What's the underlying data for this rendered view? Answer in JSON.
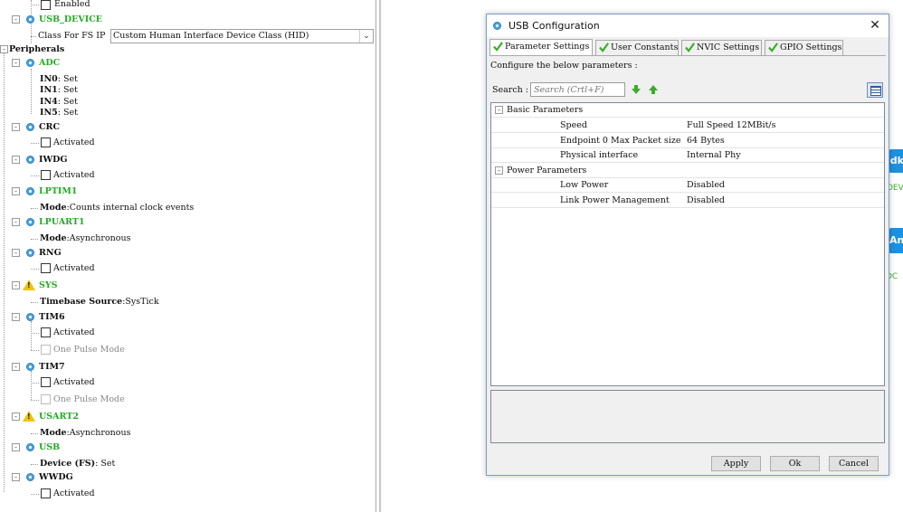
{
  "tree": {
    "enabled_label": "Enabled",
    "usb_device": "USB_DEVICE",
    "class_label": "Class For FS IP",
    "class_value": "Custom Human Interface Device Class (HID)",
    "peripherals": "Peripherals",
    "adc": "ADC",
    "in0": "IN0",
    "in1": "IN1",
    "in4": "IN4",
    "in5": "IN5",
    "set_value": "Set",
    "crc": "CRC",
    "activated": "Activated",
    "iwdg": "IWDG",
    "lptim1": "LPTIM1",
    "mode_label": "Mode",
    "lptim1_mode": "Counts internal clock events",
    "lpuart1": "LPUART1",
    "async": "Asynchronous",
    "rng": "RNG",
    "sys": "SYS",
    "timebase_label": "Timebase Source",
    "timebase_value": "SysTick",
    "tim6": "TIM6",
    "one_pulse": "One Pulse Mode",
    "tim7": "TIM7",
    "usart2": "USART2",
    "usb": "USB",
    "device_fs_label": "Device (FS)",
    "wwdg": "WWDG",
    "sep": ":"
  },
  "dialog": {
    "title": "USB Configuration",
    "close": "✕",
    "tabs": [
      "Parameter Settings",
      "User Constants",
      "NVIC Settings",
      "GPIO Settings"
    ],
    "description": "Configure the below parameters :",
    "search_label": "Search :",
    "search_placeholder": "Search (Crtl+F)",
    "groups": [
      {
        "name": "Basic Parameters",
        "params": [
          {
            "name": "Speed",
            "value": "Full Speed 12MBit/s"
          },
          {
            "name": "Endpoint 0 Max Packet size",
            "value": "64 Bytes"
          },
          {
            "name": "Physical interface",
            "value": "Internal Phy"
          }
        ]
      },
      {
        "name": "Power Parameters",
        "params": [
          {
            "name": "Low Power",
            "value": "Disabled"
          },
          {
            "name": "Link Power Management",
            "value": "Disabled"
          }
        ]
      }
    ],
    "buttons": {
      "apply": "Apply",
      "ok": "Ok",
      "cancel": "Cancel"
    }
  },
  "right_fragments": {
    "a": "ldk",
    "b": "DEV",
    "c": "An",
    "d": "DC"
  },
  "colors": {
    "ip_green": "#22aa22",
    "check_green": "#3dab2e",
    "dialog_border": "#7a9ec7"
  }
}
